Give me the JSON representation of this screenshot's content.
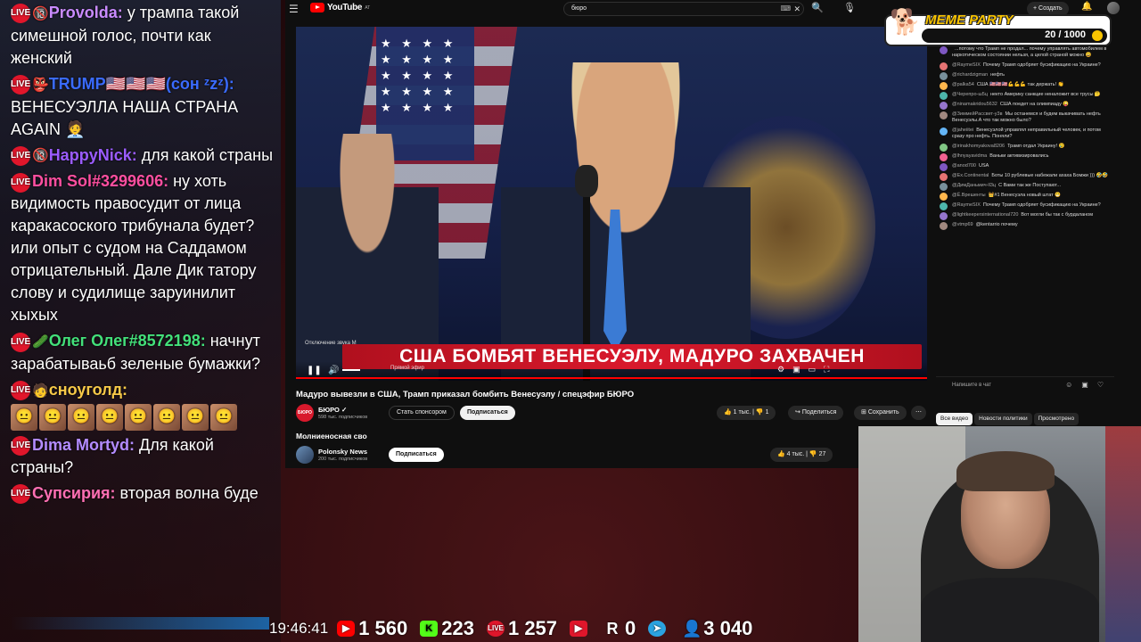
{
  "stream_chat": [
    {
      "badge": "🔞",
      "name": "Provolda:",
      "name_color": "#c98bff",
      "text": "у трампа такой симешной голос, почти как женский"
    },
    {
      "badge": "👺",
      "name": "TRUMP🇺🇸🇺🇸🇺🇸(сон ᶻzᶻ):",
      "name_color": "#3a6bff",
      "text": "ВЕНЕСУЭЛЛА НАША СТРАНА AGAIN 🧑‍💼"
    },
    {
      "badge": "🔞",
      "name": "HappyNick:",
      "name_color": "#9b5cff",
      "text": "для какой страны"
    },
    {
      "badge": "",
      "name": "Dim Sol#3299606:",
      "name_color": "#ff4fa0",
      "text": "ну хоть видимость правосудит от лица каракасоского трибунала будет? или опыт с судом на Саддамом отрицательный. Дале Дик татору слову и судилище заруинилит хыхых"
    },
    {
      "badge": "🥒",
      "name": "Олег Олег#8572198:",
      "name_color": "#43e07a",
      "text": "начнут зарабатываьб зеленые бумажки?"
    },
    {
      "badge": "🧑",
      "name": "сноуголд:",
      "name_color": "#f7c948",
      "text": ""
    },
    {
      "badge": "",
      "name": "Dima Mortyd:",
      "name_color": "#b38cff",
      "text": "Для какой страны?"
    },
    {
      "badge": "",
      "name": "Супсирия:",
      "name_color": "#ff6fb3",
      "text": "вторая волна буде"
    }
  ],
  "live_badge": "LIVE",
  "youtube": {
    "logo": "YouTube",
    "logo_sup": "AT",
    "search_value": "бюро",
    "create_label": "+ Создать",
    "banner": "США БОМБЯТ ВЕНЕСУЭЛУ, МАДУРО ЗАХВАЧЕН",
    "mute_hint": "Отключение звука  M",
    "live_label": "Прямой эфир",
    "title": "Мадуро вывезли в США, Трамп приказал бомбить Венесуэлу / спецэфир БЮРО",
    "channel": {
      "name": "БЮРО ✓",
      "subs": "598 тыс. подписчиков",
      "avatar_text": "БЮРО"
    },
    "sponsor_label": "Стать спонсором",
    "subscribe_label": "Подписаться",
    "likes": "1 тыс.",
    "dislikes": "1",
    "share_label": "Поделиться",
    "save_label": "Сохранить",
    "more_label": "⋯",
    "filters": [
      "Все видео",
      "Новости политики",
      "Просмотрено"
    ],
    "second_video": {
      "title": "Молниеносная сво",
      "channel": "Polonsky News",
      "subs": "200 тыс. подписчиков",
      "subscribe_label": "Подписаться",
      "likes": "4 тыс.",
      "dislikes": "27"
    },
    "chat": [
      {
        "author": "",
        "text": "...потому что Трамп не продал... почему управлять автомобилем в наркотическом состоянии нельзя, а целой страной можно 😄"
      },
      {
        "author": "@RaymeSIX",
        "text": "Почему Трамп одобряет бусификацию на Украине?"
      },
      {
        "author": "@richardzigman",
        "text": "нефть"
      },
      {
        "author": "@palka54",
        "text": "США 🇺🇸🇺🇸🇺🇸💪💪💪 так держать! 👏"
      },
      {
        "author": "@Черепро-ш5ц",
        "text": "некто Америку санкцие неналожит все трусы 🤔"
      },
      {
        "author": "@ninamakridou5632",
        "text": "США поедет на олимпиаду 😜"
      },
      {
        "author": "@ЗиммейРассвет-у3в",
        "text": "Мы останемся и будем выкачивать нефть Венесуэлы.А что так можно было?"
      },
      {
        "author": "@jaheiitei",
        "text": "Венесуэлой управлял неправильный человек, и потом сразу про нефть. Поняли?"
      },
      {
        "author": "@irinakhomyakova8206",
        "text": "Трамп отдал Украину! 😢"
      },
      {
        "author": "@lhnyayavidma",
        "text": "Ваньки активизировались"
      },
      {
        "author": "@anod700",
        "text": "USA"
      },
      {
        "author": "@Ex.Continental",
        "text": "Боты 10 рублевые набежали ахаха Бомжи ))) 🤣🤣"
      },
      {
        "author": "@ДимДаньмич-ll3ц",
        "text": "С Вами так же Поступают..."
      },
      {
        "author": "@Ё.Врешенты",
        "text": "👑#1 Венесуэла новый штат 😁"
      },
      {
        "author": "@RaymeSIX",
        "text": "Почему Трамп одобряет бусификацию на Украине?"
      },
      {
        "author": "@lightkeepersinternational720",
        "text": "Вот могли бы так с бурдаланом"
      },
      {
        "author": "@vtmp69",
        "text": "@kentarrio почему"
      }
    ],
    "chat_placeholder": "Напишите в чат"
  },
  "meme_party": {
    "title": "MEME PARTY",
    "count": "20 / 1000"
  },
  "stats": {
    "clock": "19:46:41",
    "youtube": "1 560",
    "kick": "223",
    "live": "1 257",
    "rumble": "",
    "r_count": "0",
    "telegram": "",
    "viewers": "3 040"
  },
  "colors": {
    "accent_red": "#e0162b",
    "yt_red": "#ff0000",
    "kick_green": "#53fc18",
    "tg_blue": "#2aa3e0"
  }
}
